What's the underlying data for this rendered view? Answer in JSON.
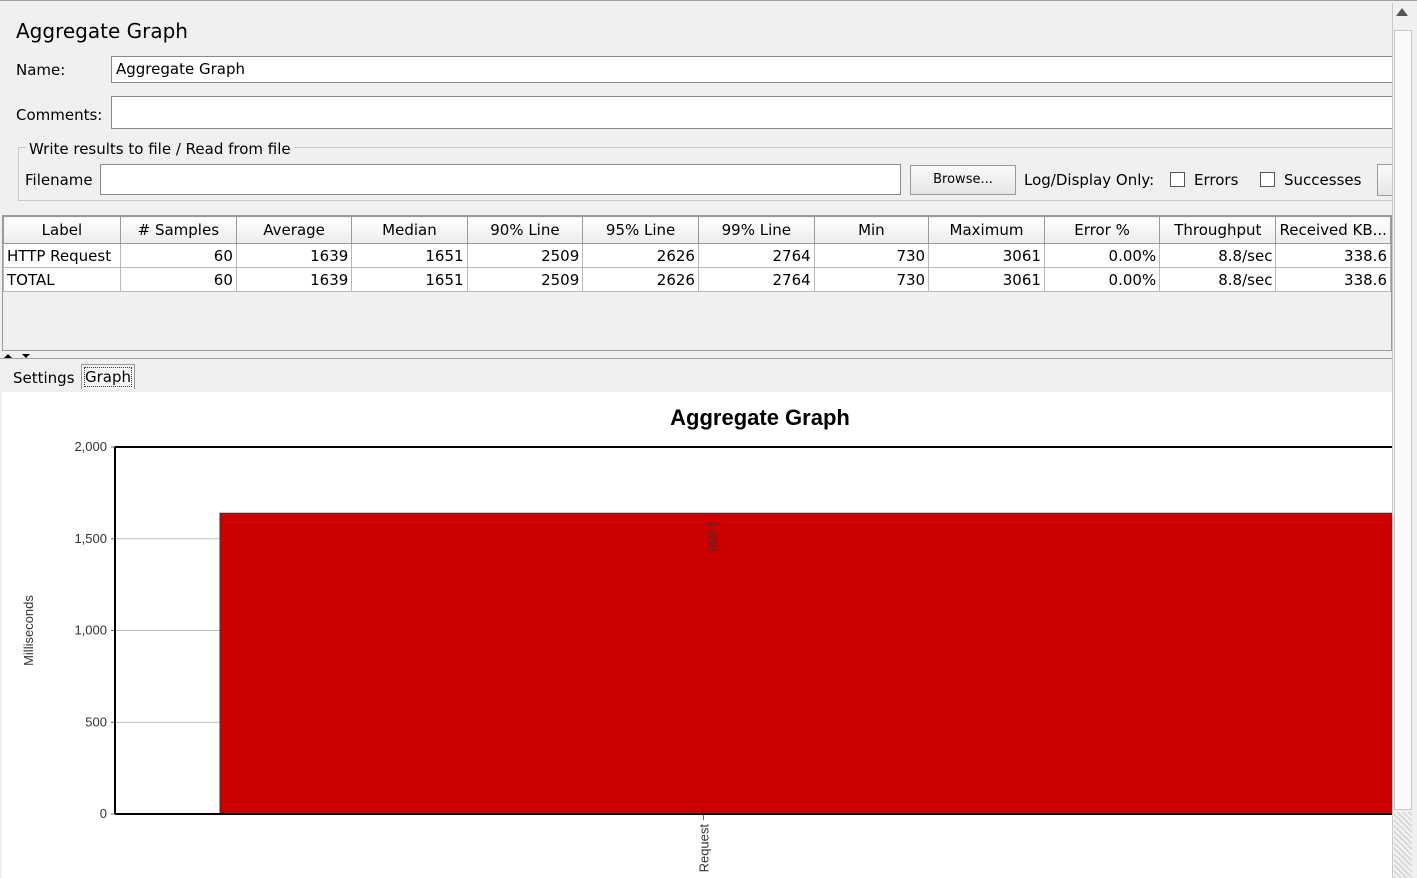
{
  "panel": {
    "title": "Aggregate Graph"
  },
  "form": {
    "name_label": "Name:",
    "name_value": "Aggregate Graph",
    "comments_label": "Comments:",
    "comments_value": "",
    "file_group_label": "Write results to file / Read from file",
    "filename_label": "Filename",
    "filename_value": "",
    "browse_label": "Browse...",
    "log_display_label": "Log/Display Only:",
    "errors_label": "Errors",
    "errors_checked": false,
    "successes_label": "Successes",
    "successes_checked": false
  },
  "table": {
    "columns": [
      "Label",
      "# Samples",
      "Average",
      "Median",
      "90% Line",
      "95% Line",
      "99% Line",
      "Min",
      "Maximum",
      "Error %",
      "Throughput",
      "Received KB..."
    ],
    "rows": [
      [
        "HTTP Request",
        "60",
        "1639",
        "1651",
        "2509",
        "2626",
        "2764",
        "730",
        "3061",
        "0.00%",
        "8.8/sec",
        "338.6"
      ],
      [
        "TOTAL",
        "60",
        "1639",
        "1651",
        "2509",
        "2626",
        "2764",
        "730",
        "3061",
        "0.00%",
        "8.8/sec",
        "338.6"
      ]
    ]
  },
  "tabs": [
    "Settings",
    "Graph"
  ],
  "active_tab": "Graph",
  "colors": {
    "bar": "#cc0000",
    "background": "#f0f0f0"
  },
  "chart_data": {
    "type": "bar",
    "title": "Aggregate Graph",
    "ylabel": "Milliseconds",
    "xlabel": "",
    "ylim": [
      0,
      2000
    ],
    "yticks": [
      0,
      500,
      1000,
      1500,
      2000
    ],
    "ytick_labels": [
      "0",
      "500",
      "1,000",
      "1,500",
      "2,000"
    ],
    "categories": [
      "Request"
    ],
    "values": [
      1639
    ],
    "value_labels": [
      "1,639"
    ],
    "grid": true,
    "legend": "none"
  }
}
